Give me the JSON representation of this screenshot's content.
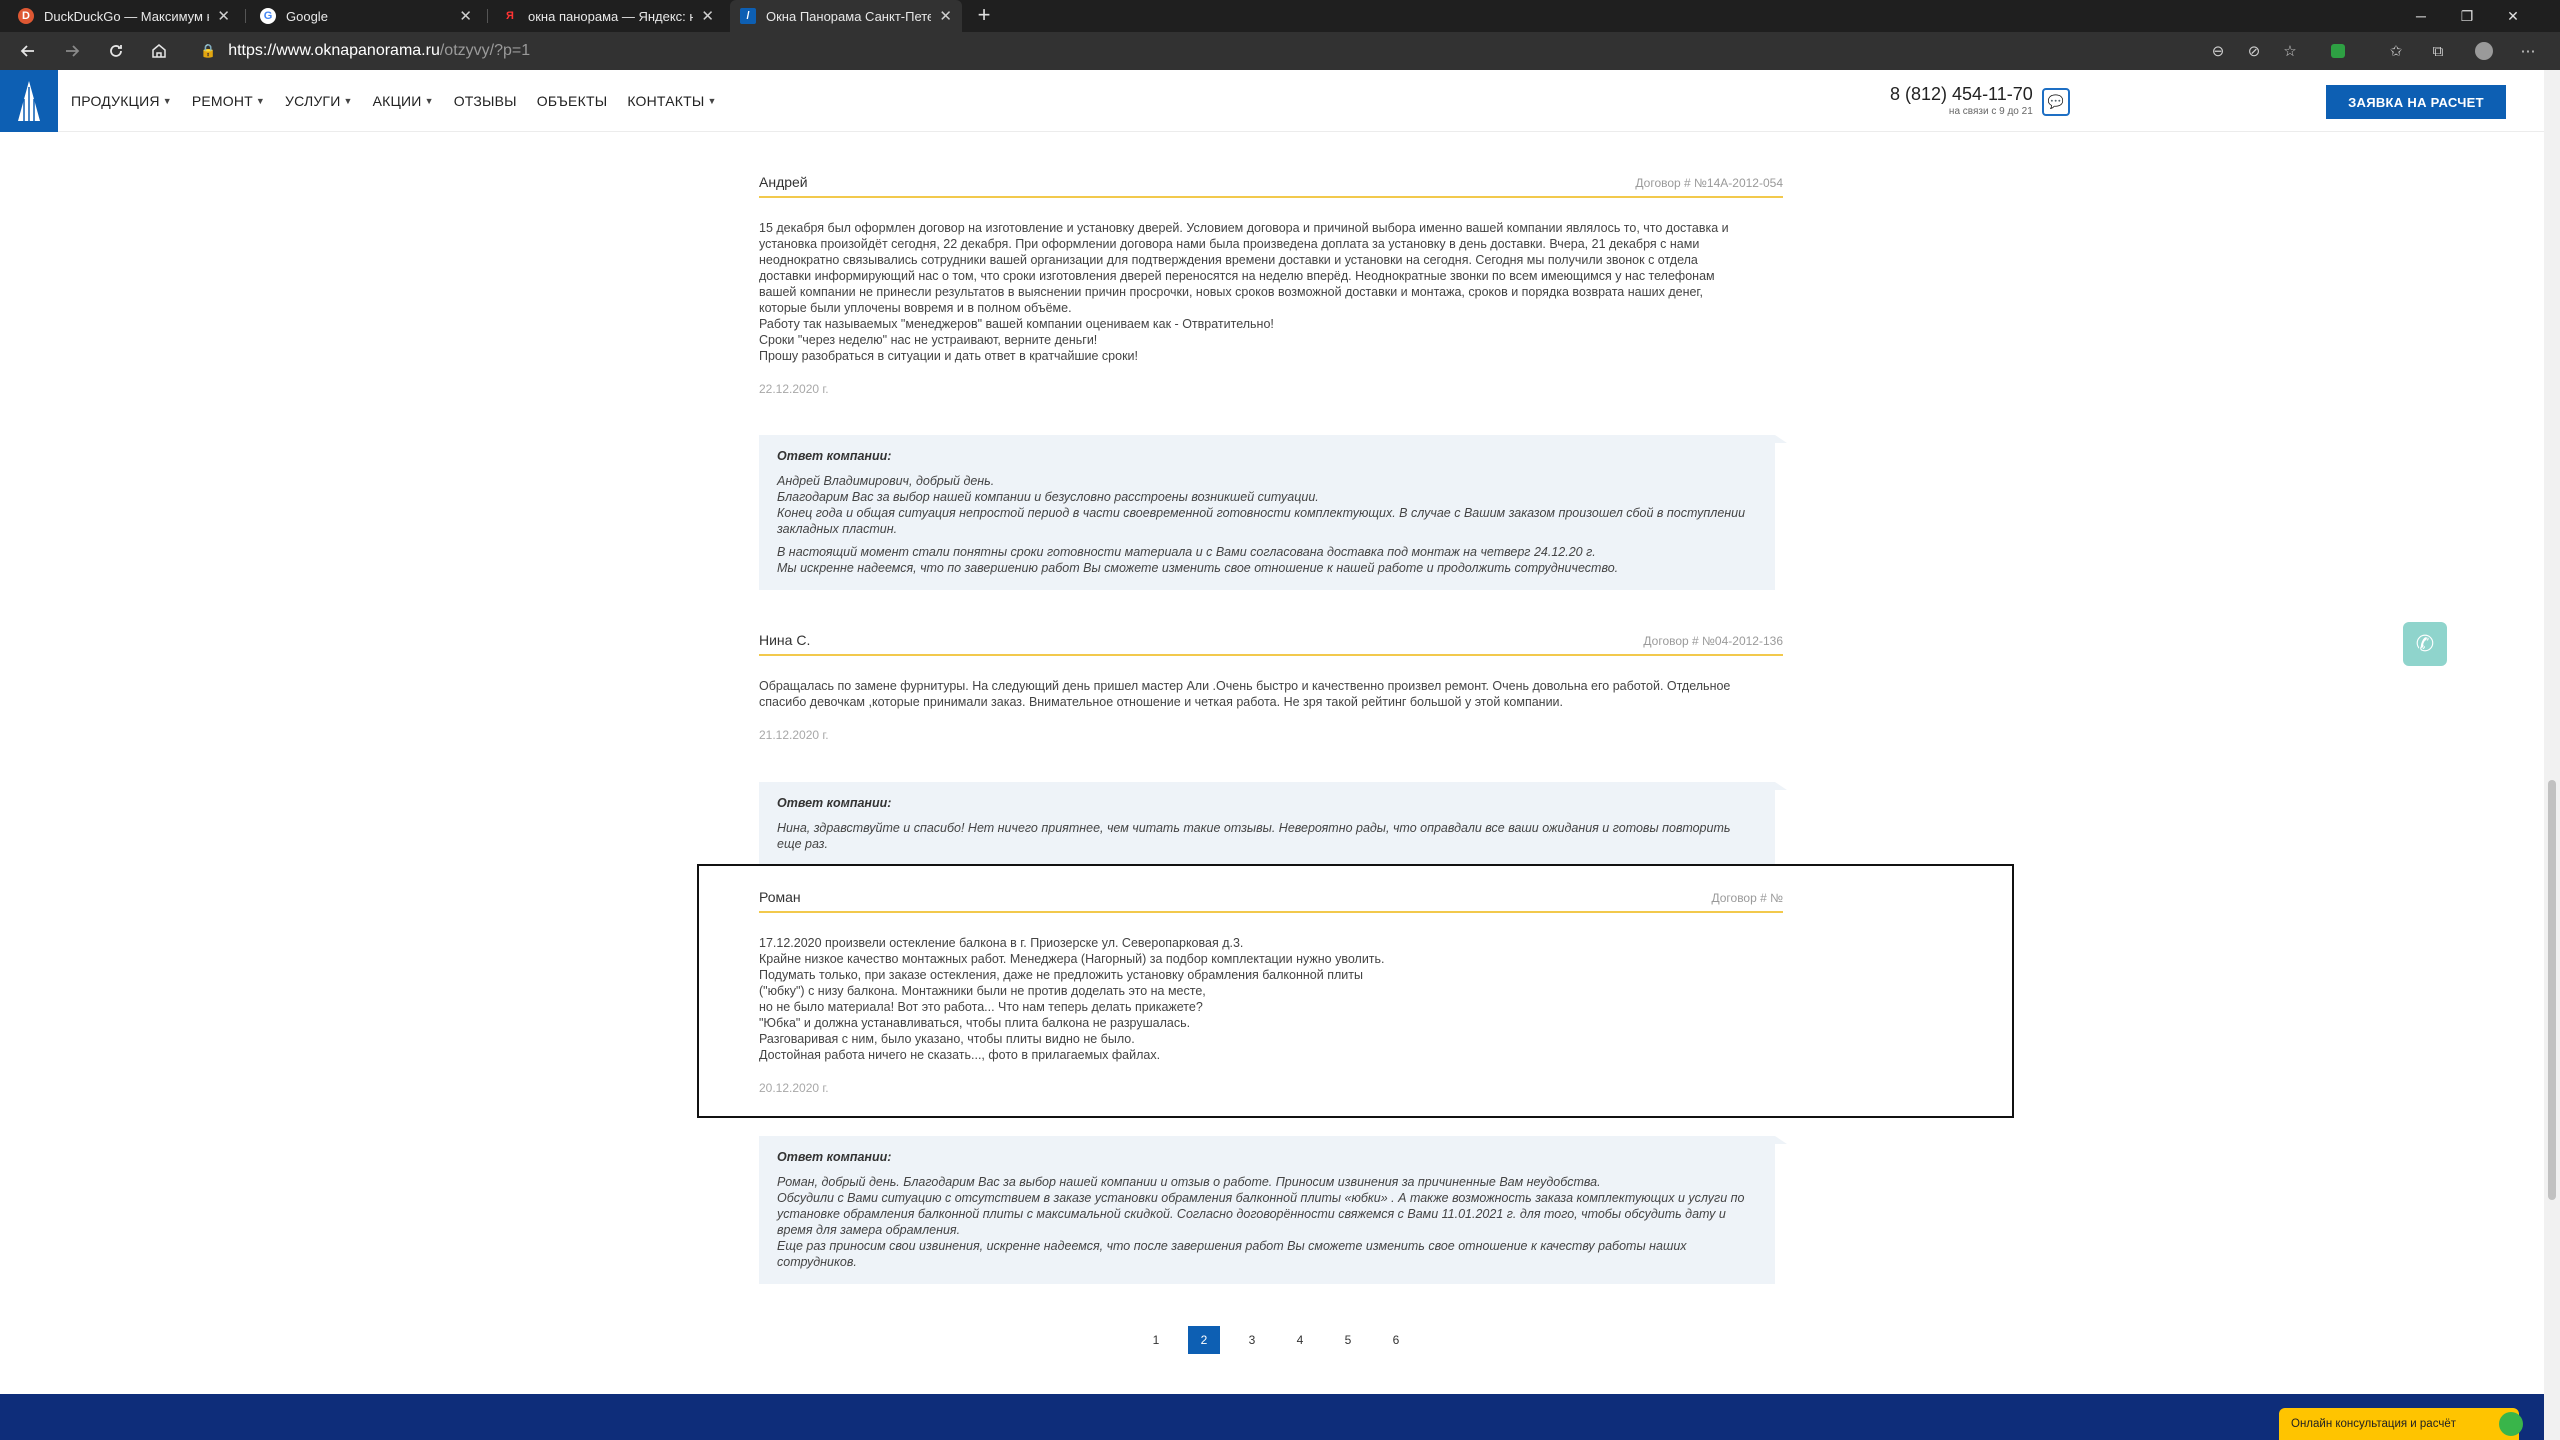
{
  "browser": {
    "tabs": [
      {
        "title": "DuckDuckGo — Максимум конфиденциальности",
        "icon": "duckduckgo-icon"
      },
      {
        "title": "Google",
        "icon": "google-icon"
      },
      {
        "title": "окна панорама — Яндекс: нашлось",
        "icon": "yandex-icon"
      },
      {
        "title": "Окна Панорама Санкт-Петербург",
        "icon": "site-favicon"
      }
    ],
    "active_tab": 3,
    "url_host": "https://www.oknapanorama.ru",
    "url_path": "/otzyvy/?p=1"
  },
  "header": {
    "menu": [
      {
        "label": "ПРОДУКЦИЯ",
        "dropdown": true
      },
      {
        "label": "РЕМОНТ",
        "dropdown": true
      },
      {
        "label": "УСЛУГИ",
        "dropdown": true
      },
      {
        "label": "АКЦИИ",
        "dropdown": true
      },
      {
        "label": "ОТЗЫВЫ",
        "dropdown": false
      },
      {
        "label": "ОБЪЕКТЫ",
        "dropdown": false
      },
      {
        "label": "КОНТАКТЫ",
        "dropdown": true
      }
    ],
    "phone": "8 (812) 454-11-70",
    "phone_hours": "на связи с 9 до 21",
    "order_button": "ЗАЯВКА НА РАСЧЕТ"
  },
  "reviews": [
    {
      "name": "Андрей",
      "contract": "Договор # №14А-2012-054",
      "text": [
        "15 декабря был оформлен договор на изготовление и установку дверей. Условием договора и причиной выбора именно вашей компании являлось то, что доставка и",
        "установка произойдёт сегодня, 22 декабря. При оформлении договора нами была произведена доплата за установку в день доставки. Вчера, 21 декабря с нами",
        "неоднократно связывались сотрудники вашей организации для подтверждения времени доставки и установки на сегодня. Сегодня мы получили звонок с отдела",
        "доставки информирующий нас о том, что сроки изготовления дверей переносятся на неделю вперёд. Неоднократные звонки по всем имеющимся у нас телефонам",
        "вашей компании не принесли результатов в выяснении причин просрочки, новых сроков возможной доставки и монтажа, сроков и порядка возврата наших денег,",
        "которые были уплочены вовремя и в полном объёме.",
        "Работу так называемых \"менеджеров\" вашей компании оцениваем как - Отвратительно!",
        "Сроки \"через неделю\" нас не устраивают, верните деньги!",
        "Прошу разобраться в ситуации и дать ответ в кратчайшие сроки!"
      ],
      "date": "22.12.2020 г.",
      "answer_title": "Ответ компании:",
      "answer": [
        "Андрей Владимирович, добрый день.",
        "Благодарим Вас за выбор нашей компании и безусловно расстроены возникшей ситуации.",
        "Конец года и общая ситуация непростой период в части своевременной готовности комплектующих. В случае с Вашим заказом произошел сбой в поступлении",
        "закладных пластин.",
        "В настоящий момент стали понятны сроки готовности материала и с Вами согласована доставка под монтаж на четверг 24.12.20 г.",
        "Мы искренне надеемся, что по завершению работ Вы сможете изменить свое отношение к нашей работе и продолжить сотрудничество."
      ]
    },
    {
      "name": "Нина С.",
      "contract": "Договор # №04-2012-136",
      "text": [
        "Обращалась по замене фурнитуры. На следующий день пришел мастер Али .Очень быстро и качественно произвел ремонт. Очень довольна его работой. Отдельное",
        "спасибо девочкам ,которые принимали заказ. Внимательное отношение и четкая работа. Не зря такой рейтинг большой у этой компании."
      ],
      "date": "21.12.2020 г.",
      "answer_title": "Ответ компании:",
      "answer": [
        "Нина, здравствуйте и спасибо! Нет ничего приятнее, чем читать такие отзывы. Невероятно рады, что оправдали все ваши ожидания и готовы повторить еще раз."
      ]
    },
    {
      "name": "Роман",
      "contract": "Договор # №",
      "text": [
        "17.12.2020 произвели остекление балкона в г. Приозерске ул. Северопарковая д.3.",
        "Крайне низкое качество монтажных работ. Менеджера (Нагорный) за подбор комплектации нужно уволить.",
        "Подумать только, при заказе остекления, даже не предложить установку обрамления балконной плиты",
        "(\"юбку\") с низу балкона. Монтажники были не против доделать это на месте,",
        "но не было материала! Вот это работа... Что нам теперь делать прикажете?",
        "\"Юбка\" и должна устанавливаться, чтобы плита балкона не разрушалась.",
        "Разговаривая с ним, было указано, чтобы плиты видно не было.",
        "Достойная работа ничего не сказать..., фото в прилагаемых файлах."
      ],
      "date": "20.12.2020 г.",
      "answer_title": "Ответ компании:",
      "answer": [
        "Роман, добрый день. Благодарим Вас за выбор нашей компании и отзыв о работе. Приносим извинения за причиненные Вам неудобства.",
        "Обсудили с Вами ситуацию с отсутствием в заказе установки обрамления балконной плиты «юбки» . А также возможность заказа комплектующих и услуги по",
        "установке обрамления балконной плиты с максимальной скидкой. Согласно договорённости свяжемся с Вами 11.01.2021 г. для того, чтобы обсудить дату и",
        "время для замера обрамления.",
        "Еще раз приносим свои извинения, искренне надеемся, что после завершения работ Вы сможете изменить свое отношение к качеству работы наших",
        "сотрудников."
      ]
    }
  ],
  "pagination": {
    "pages": [
      "1",
      "2",
      "3",
      "4",
      "5",
      "6"
    ],
    "current": "2"
  },
  "widgets": {
    "consult": "Онлайн консультация и расчёт"
  },
  "colors": {
    "brand": "#0d5fb3",
    "accent_line": "#f2c94c",
    "answer_bg": "#eef3f8",
    "footer": "#0e2d7a",
    "consult": "#ffc400"
  }
}
